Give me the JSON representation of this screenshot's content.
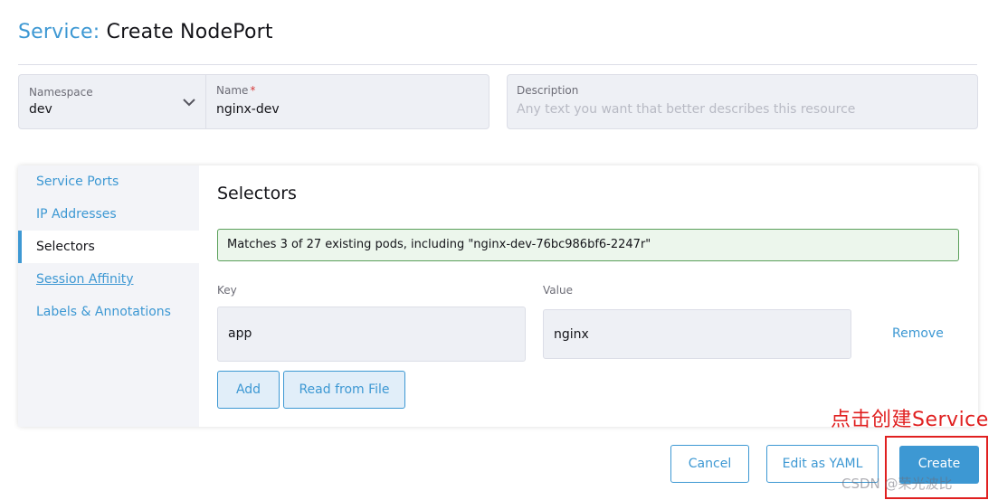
{
  "header": {
    "crumb": "Service",
    "separator": ":",
    "title": "Create NodePort"
  },
  "form": {
    "namespace": {
      "label": "Namespace",
      "value": "dev"
    },
    "name": {
      "label": "Name",
      "required_mark": "*",
      "value": "nginx-dev"
    },
    "description": {
      "label": "Description",
      "placeholder": "Any text you want that better describes this resource"
    }
  },
  "tabs": [
    {
      "label": "Service Ports"
    },
    {
      "label": "IP Addresses"
    },
    {
      "label": "Selectors"
    },
    {
      "label": "Session Affinity"
    },
    {
      "label": "Labels & Annotations"
    }
  ],
  "active_tab": "Selectors",
  "selectors": {
    "heading": "Selectors",
    "match_message": "Matches 3 of 27 existing pods, including \"nginx-dev-76bc986bf6-2247r\"",
    "key_label": "Key",
    "value_label": "Value",
    "rows": [
      {
        "key": "app",
        "value": "nginx",
        "remove_label": "Remove"
      }
    ],
    "add_label": "Add",
    "read_file_label": "Read from File"
  },
  "footer": {
    "cancel_label": "Cancel",
    "edit_yaml_label": "Edit as YAML",
    "create_label": "Create"
  },
  "annotation": {
    "text": "点击创建Service"
  },
  "watermark": "CSDN @荣光波比",
  "colors": {
    "accent": "#3d98d3",
    "success_border": "#5aa05a",
    "success_bg": "#ecf6ec",
    "annotation": "#e02020"
  },
  "icons": {
    "namespace_dropdown": "chevron-down-icon"
  }
}
